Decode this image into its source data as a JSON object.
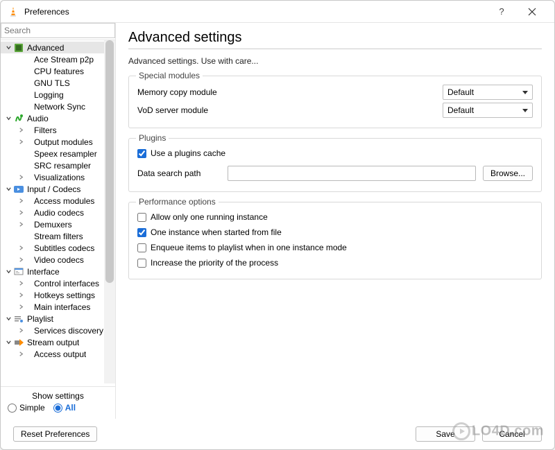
{
  "titlebar": {
    "title": "Preferences",
    "help": "?",
    "close": "×"
  },
  "search": {
    "placeholder": "Search"
  },
  "tree": [
    {
      "level": 0,
      "label": "Advanced",
      "caret": "down",
      "icon": "advanced",
      "selected": true
    },
    {
      "level": 1,
      "label": "Ace Stream p2p",
      "caret": "none"
    },
    {
      "level": 1,
      "label": "CPU features",
      "caret": "none"
    },
    {
      "level": 1,
      "label": "GNU TLS",
      "caret": "none"
    },
    {
      "level": 1,
      "label": "Logging",
      "caret": "none"
    },
    {
      "level": 1,
      "label": "Network Sync",
      "caret": "none"
    },
    {
      "level": 0,
      "label": "Audio",
      "caret": "down",
      "icon": "audio"
    },
    {
      "level": 1,
      "label": "Filters",
      "caret": "right"
    },
    {
      "level": 1,
      "label": "Output modules",
      "caret": "right"
    },
    {
      "level": 1,
      "label": "Speex resampler",
      "caret": "none"
    },
    {
      "level": 1,
      "label": "SRC resampler",
      "caret": "none"
    },
    {
      "level": 1,
      "label": "Visualizations",
      "caret": "right"
    },
    {
      "level": 0,
      "label": "Input / Codecs",
      "caret": "down",
      "icon": "codecs"
    },
    {
      "level": 1,
      "label": "Access modules",
      "caret": "right"
    },
    {
      "level": 1,
      "label": "Audio codecs",
      "caret": "right"
    },
    {
      "level": 1,
      "label": "Demuxers",
      "caret": "right"
    },
    {
      "level": 1,
      "label": "Stream filters",
      "caret": "none"
    },
    {
      "level": 1,
      "label": "Subtitles codecs",
      "caret": "right"
    },
    {
      "level": 1,
      "label": "Video codecs",
      "caret": "right"
    },
    {
      "level": 0,
      "label": "Interface",
      "caret": "down",
      "icon": "interface"
    },
    {
      "level": 1,
      "label": "Control interfaces",
      "caret": "right"
    },
    {
      "level": 1,
      "label": "Hotkeys settings",
      "caret": "right"
    },
    {
      "level": 1,
      "label": "Main interfaces",
      "caret": "right"
    },
    {
      "level": 0,
      "label": "Playlist",
      "caret": "down",
      "icon": "playlist"
    },
    {
      "level": 1,
      "label": "Services discovery",
      "caret": "right"
    },
    {
      "level": 0,
      "label": "Stream output",
      "caret": "down",
      "icon": "sout"
    },
    {
      "level": 1,
      "label": "Access output",
      "caret": "right"
    }
  ],
  "show_settings": {
    "header": "Show settings",
    "simple": "Simple",
    "all": "All"
  },
  "content": {
    "title": "Advanced settings",
    "subtitle": "Advanced settings. Use with care...",
    "special_modules": {
      "legend": "Special modules",
      "memory_copy": {
        "label": "Memory copy module",
        "value": "Default"
      },
      "vod_server": {
        "label": "VoD server module",
        "value": "Default"
      }
    },
    "plugins": {
      "legend": "Plugins",
      "use_cache": {
        "label": "Use a plugins cache",
        "checked": true
      },
      "data_path": {
        "label": "Data search path",
        "value": "",
        "browse": "Browse..."
      }
    },
    "performance": {
      "legend": "Performance options",
      "one_instance": {
        "label": "Allow only one running instance",
        "checked": false
      },
      "one_from_file": {
        "label": "One instance when started from file",
        "checked": true
      },
      "enqueue": {
        "label": "Enqueue items to playlist when in one instance mode",
        "checked": false
      },
      "priority": {
        "label": "Increase the priority of the process",
        "checked": false
      }
    }
  },
  "footer": {
    "reset": "Reset Preferences",
    "save": "Save",
    "cancel": "Cancel"
  },
  "watermark": "LO4D.com"
}
